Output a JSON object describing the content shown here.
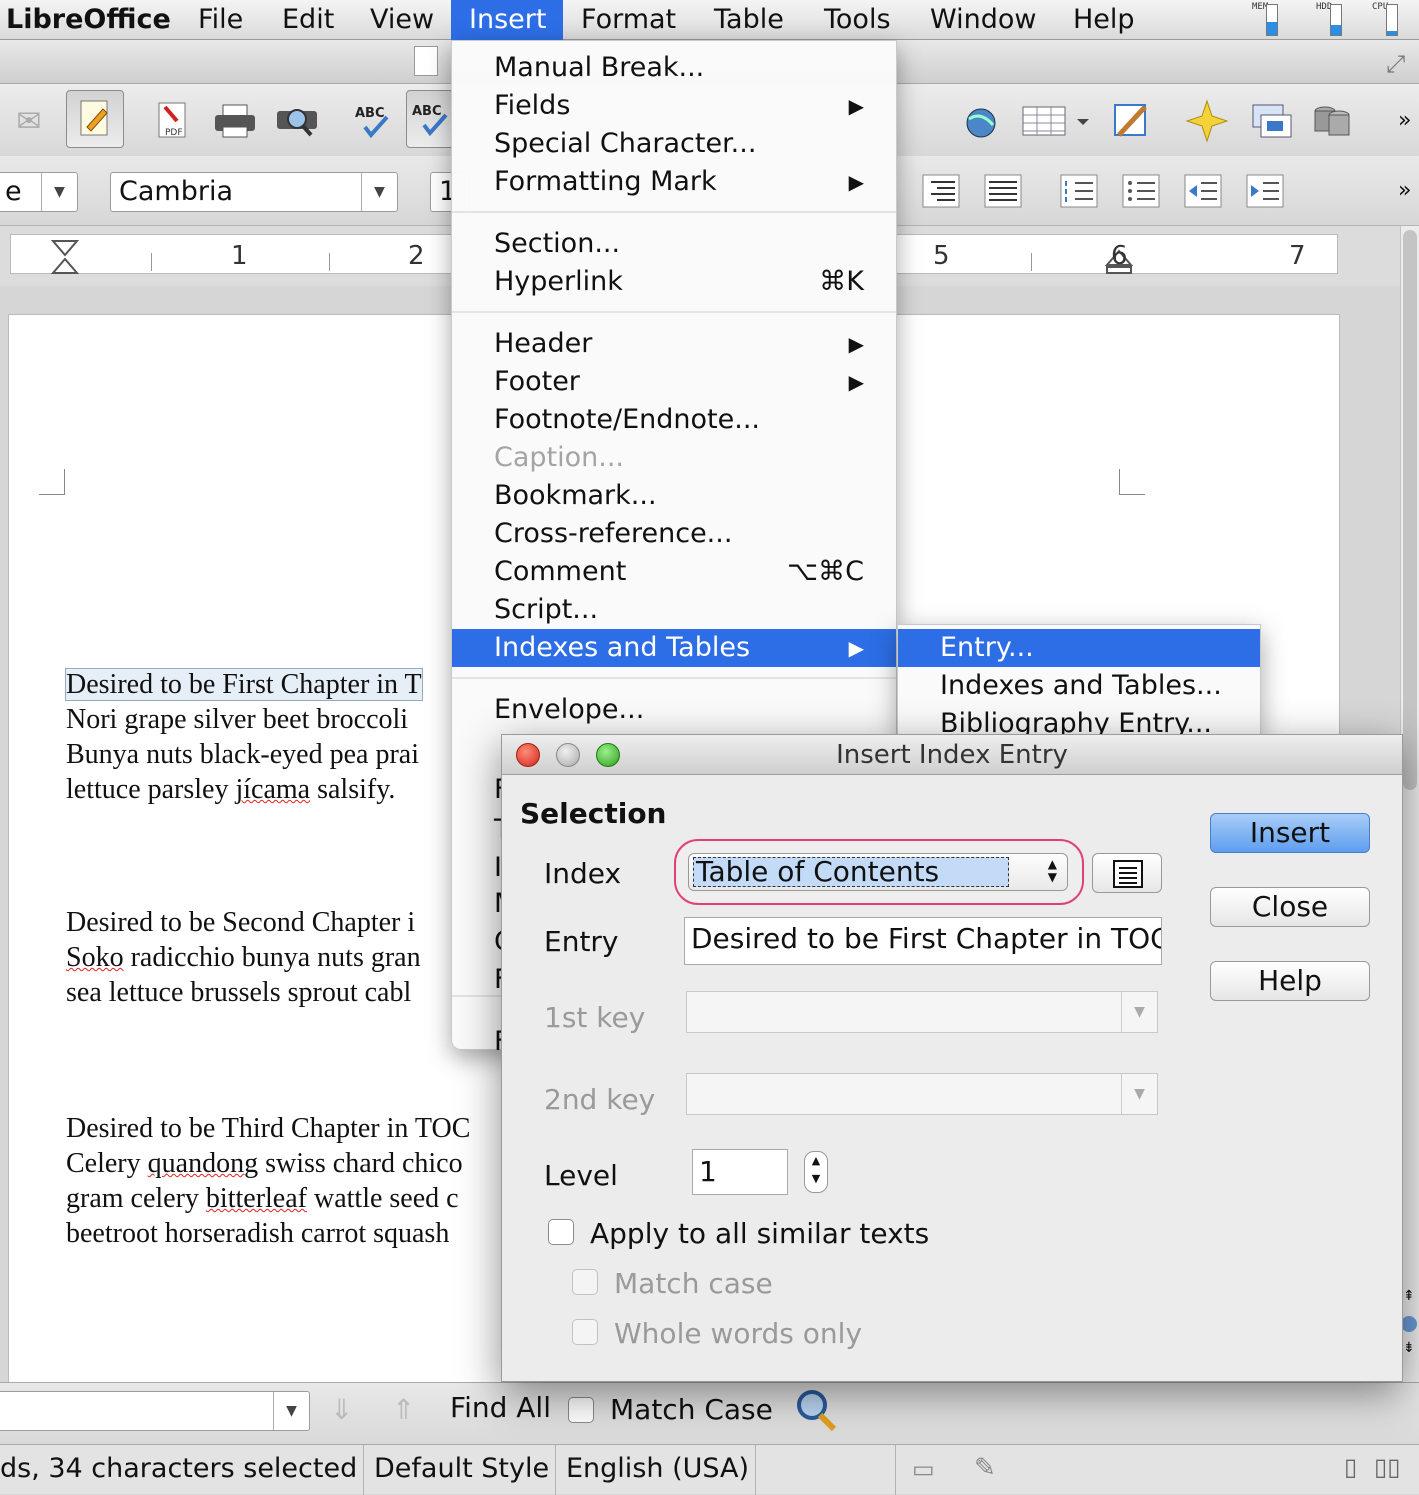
{
  "menubar": {
    "app": "LibreOffice",
    "items": [
      "File",
      "Edit",
      "View",
      "Insert",
      "Format",
      "Table",
      "Tools",
      "Window",
      "Help"
    ],
    "meters": [
      {
        "label": "MEM",
        "level": 0.45
      },
      {
        "label": "HDD",
        "level": 0.35
      },
      {
        "label": "CPU",
        "level": 0.15
      }
    ]
  },
  "formatting": {
    "style_value": "e",
    "font_name": "Cambria",
    "font_size_partial": "1"
  },
  "ruler": {
    "numbers": [
      "1",
      "2",
      "5",
      "6",
      "7"
    ]
  },
  "document": {
    "paragraphs": [
      {
        "lines": [
          {
            "pre": "Desired to be First Chapter in T",
            "squig": "",
            "post": ""
          },
          {
            "pre": "Nori grape silver beet broccoli ",
            "squig": "",
            "post": ""
          },
          {
            "pre": "Bunya nuts black-eyed pea prai",
            "squig": "",
            "post": ""
          },
          {
            "pre": "lettuce parsley ",
            "squig": "jícama",
            "post": " salsify."
          }
        ]
      },
      {
        "lines": [
          {
            "pre": "Desired to be Second Chapter i",
            "squig": "",
            "post": ""
          },
          {
            "pre": "",
            "squig": "Soko",
            "post": " radicchio bunya nuts gran"
          },
          {
            "pre": "sea lettuce brussels sprout cabl",
            "squig": "",
            "post": ""
          }
        ]
      },
      {
        "lines": [
          {
            "pre": "Desired to be Third Chapter in TOC",
            "squig": "",
            "post": ""
          },
          {
            "pre": "Celery ",
            "squig": "quandong",
            "post": " swiss chard chico"
          },
          {
            "pre": "gram celery ",
            "squig": "bitterleaf",
            "post": " wattle seed c"
          },
          {
            "pre": "beetroot horseradish carrot squash",
            "squig": "",
            "post": ""
          }
        ]
      }
    ]
  },
  "insert_menu": {
    "groups": [
      [
        {
          "label": "Manual Break...",
          "submenu": false,
          "shortcut": "",
          "disabled": false
        },
        {
          "label": "Fields",
          "submenu": true,
          "shortcut": "",
          "disabled": false
        },
        {
          "label": "Special Character...",
          "submenu": false,
          "shortcut": "",
          "disabled": false
        },
        {
          "label": "Formatting Mark",
          "submenu": true,
          "shortcut": "",
          "disabled": false
        }
      ],
      [
        {
          "label": "Section...",
          "submenu": false,
          "shortcut": "",
          "disabled": false
        },
        {
          "label": "Hyperlink",
          "submenu": false,
          "shortcut": "⌘K",
          "disabled": false
        }
      ],
      [
        {
          "label": "Header",
          "submenu": true,
          "shortcut": "",
          "disabled": false
        },
        {
          "label": "Footer",
          "submenu": true,
          "shortcut": "",
          "disabled": false
        },
        {
          "label": "Footnote/Endnote...",
          "submenu": false,
          "shortcut": "",
          "disabled": false
        },
        {
          "label": "Caption...",
          "submenu": false,
          "shortcut": "",
          "disabled": true
        },
        {
          "label": "Bookmark...",
          "submenu": false,
          "shortcut": "",
          "disabled": false
        },
        {
          "label": "Cross-reference...",
          "submenu": false,
          "shortcut": "",
          "disabled": false
        },
        {
          "label": "Comment",
          "submenu": false,
          "shortcut": "⌥⌘C",
          "disabled": false
        },
        {
          "label": "Script...",
          "submenu": false,
          "shortcut": "",
          "disabled": false
        },
        {
          "label": "Indexes and Tables",
          "submenu": true,
          "shortcut": "",
          "disabled": false,
          "highlighted": true
        }
      ],
      [
        {
          "label": "Envelope...",
          "submenu": false,
          "shortcut": "",
          "disabled": false
        }
      ]
    ],
    "obscured_letters": [
      "F",
      "T",
      "I",
      "M",
      "C",
      "F",
      "F"
    ]
  },
  "submenu": {
    "items": [
      {
        "label": "Entry...",
        "highlighted": true
      },
      {
        "label": "Indexes and Tables...",
        "highlighted": false
      },
      {
        "label": "Bibliography Entry...",
        "highlighted": false
      }
    ]
  },
  "dialog": {
    "title": "Insert Index Entry",
    "section": "Selection",
    "index_label": "Index",
    "index_value": "Table of Contents",
    "entry_label": "Entry",
    "entry_value": "Desired to be First Chapter in TOC",
    "key1_label": "1st key",
    "key2_label": "2nd key",
    "level_label": "Level",
    "level_value": "1",
    "apply_all": "Apply to all similar texts",
    "match_case": "Match case",
    "whole_words": "Whole words only",
    "buttons": {
      "insert": "Insert",
      "close": "Close",
      "help": "Help"
    }
  },
  "findbar": {
    "find_all": "Find All",
    "match_case": "Match Case"
  },
  "status": {
    "words": "ds, 34 characters selected",
    "page_style": "Default Style",
    "language": "English (USA)"
  },
  "colors": {
    "accent": "#2d6ee6",
    "index_focus_ring": "#e0407a",
    "spell_underline": "#e02020"
  }
}
